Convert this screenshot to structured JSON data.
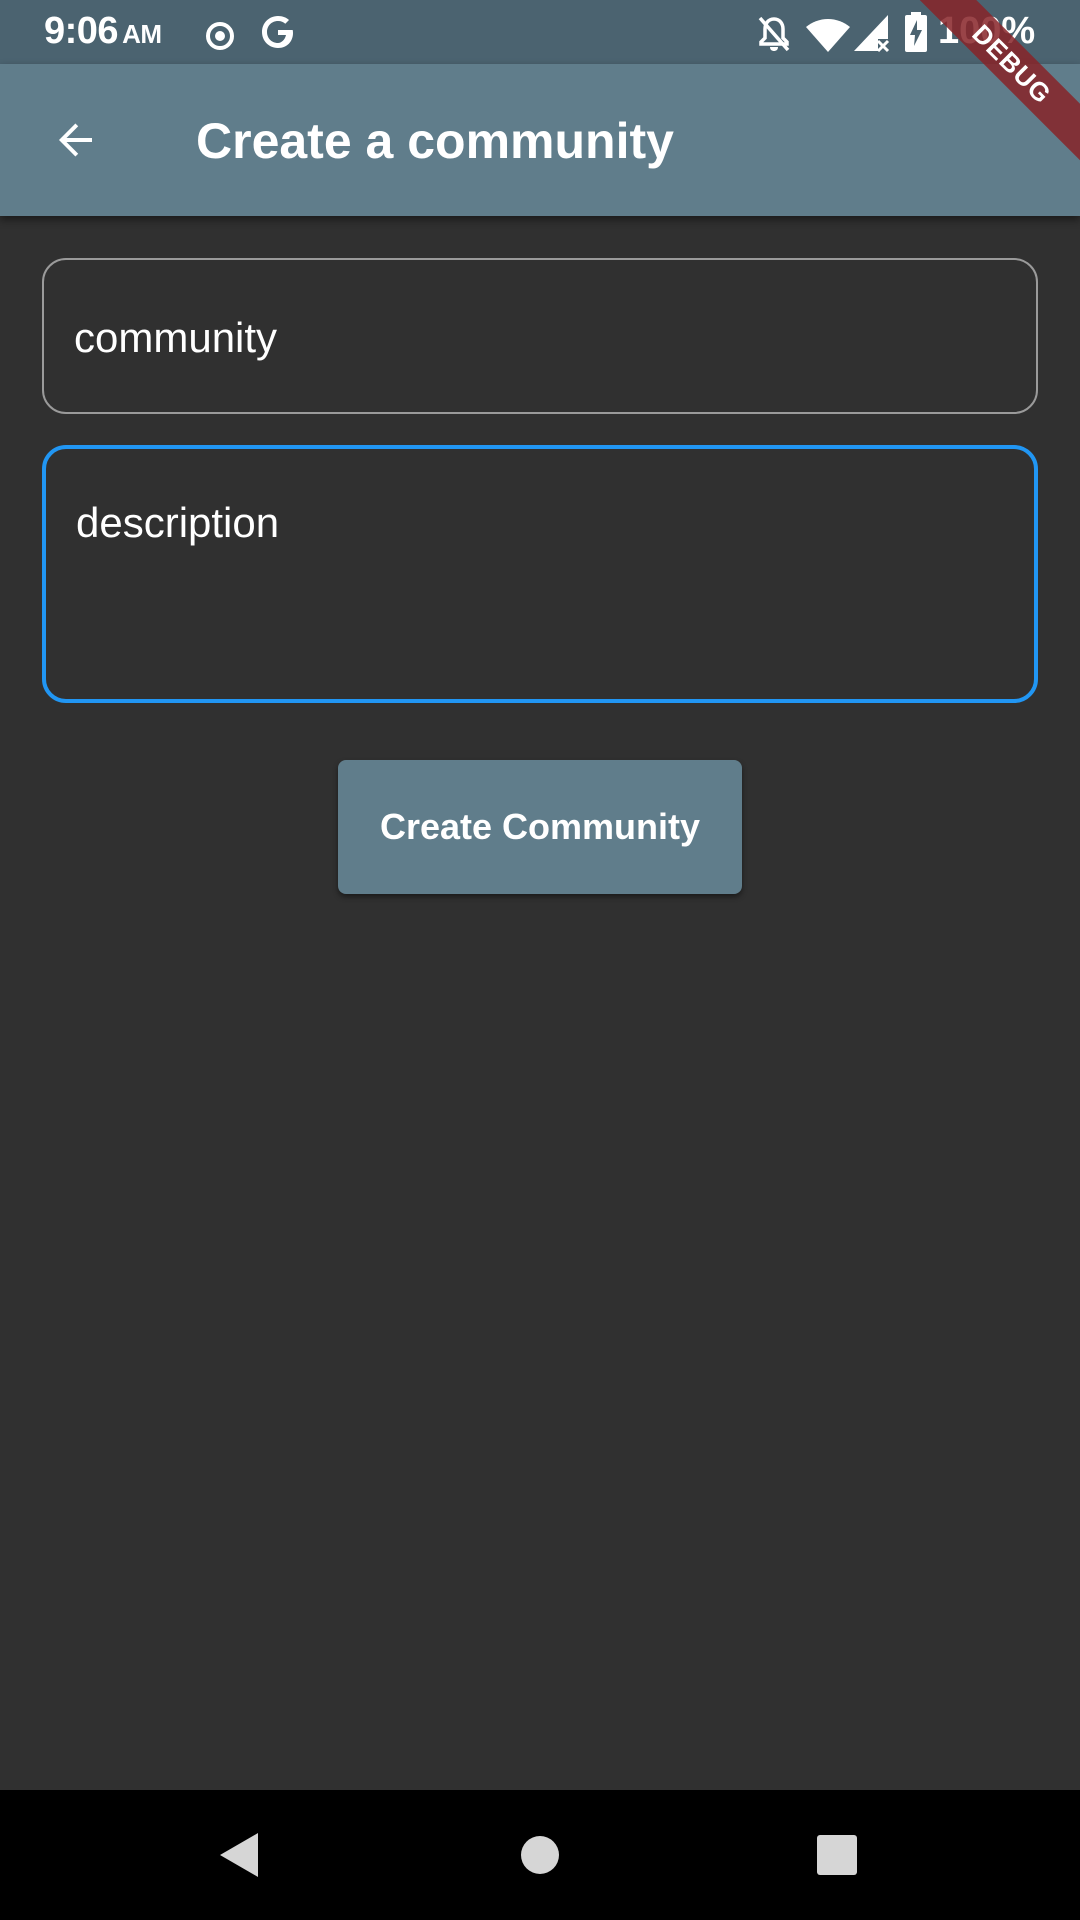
{
  "status_bar": {
    "time": "9:06",
    "ampm": "AM",
    "battery": "100%",
    "icons": [
      "location-icon",
      "google-icon",
      "notifications-off-icon",
      "wifi-icon",
      "cell-signal-icon",
      "battery-charging-icon"
    ],
    "background_color": "#4b6370"
  },
  "debug_banner": {
    "label": "DEBUG",
    "color": "#872328"
  },
  "app_bar": {
    "title": "Create a community",
    "back_icon": "arrow-back-icon",
    "background_color": "#607d8b"
  },
  "form": {
    "community_field": {
      "placeholder": "community",
      "value": ""
    },
    "description_field": {
      "placeholder": "description",
      "value": "",
      "focused": true,
      "focus_color": "#2196f3"
    },
    "submit_label": "Create Community"
  },
  "nav_bar": {
    "icons": [
      "nav-back-icon",
      "nav-home-icon",
      "nav-recents-icon"
    ]
  }
}
